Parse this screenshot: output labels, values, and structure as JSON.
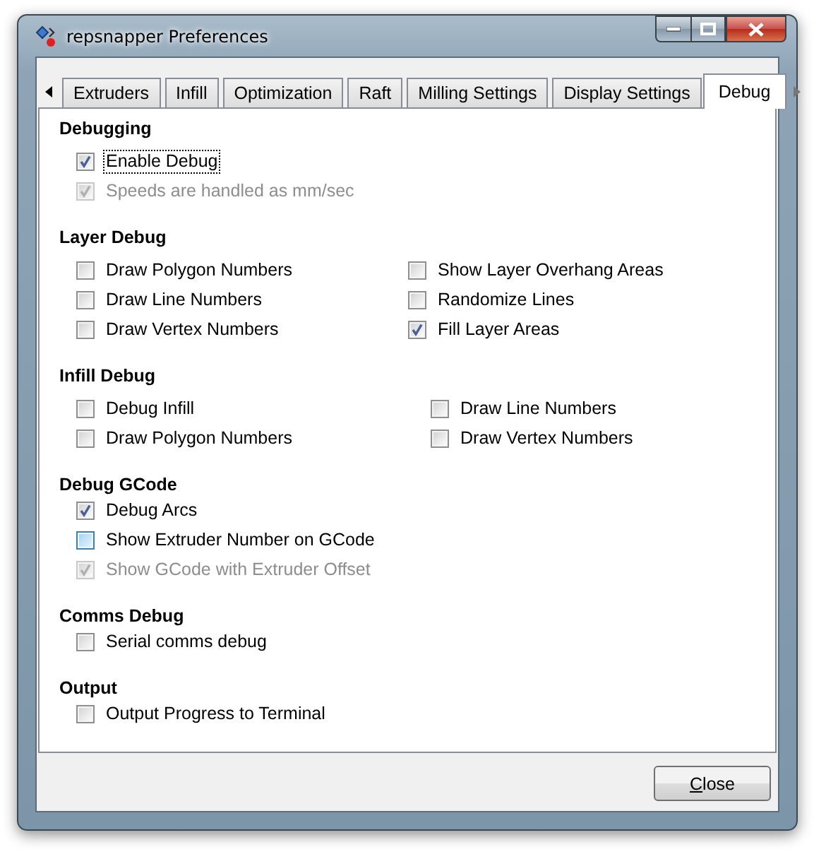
{
  "window": {
    "title": "repsnapper Preferences"
  },
  "tabs": [
    {
      "label": "Extruders",
      "selected": false
    },
    {
      "label": "Infill",
      "selected": false
    },
    {
      "label": "Optimization",
      "selected": false
    },
    {
      "label": "Raft",
      "selected": false
    },
    {
      "label": "Milling Settings",
      "selected": false
    },
    {
      "label": "Display Settings",
      "selected": false
    },
    {
      "label": "Debug",
      "selected": true
    }
  ],
  "sections": [
    {
      "heading": "Debugging",
      "columns": [
        [
          {
            "kind": "plain",
            "label": "Enable Debug",
            "checked": true,
            "disabled": false,
            "focused": true
          },
          {
            "kind": "plain",
            "label": "Speeds are handled as mm/sec",
            "checked": true,
            "disabled": true,
            "focused": false
          }
        ]
      ]
    },
    {
      "heading": "Layer Debug",
      "columns": [
        [
          {
            "kind": "plain",
            "label": "Draw Polygon Numbers",
            "checked": false,
            "disabled": false,
            "focused": false
          },
          {
            "kind": "plain",
            "label": "Draw Line Numbers",
            "checked": false,
            "disabled": false,
            "focused": false
          },
          {
            "kind": "plain",
            "label": "Draw Vertex Numbers",
            "checked": false,
            "disabled": false,
            "focused": false
          }
        ],
        [
          {
            "kind": "plain",
            "label": "Show Layer Overhang Areas",
            "checked": false,
            "disabled": false,
            "focused": false
          },
          {
            "kind": "plain",
            "label": "Randomize Lines",
            "checked": false,
            "disabled": false,
            "focused": false
          },
          {
            "kind": "plain",
            "label": "Fill Layer Areas",
            "checked": true,
            "disabled": false,
            "focused": false
          }
        ]
      ]
    },
    {
      "heading": "Infill Debug",
      "columns": [
        [
          {
            "kind": "plain",
            "label": "Debug Infill",
            "checked": false,
            "disabled": false,
            "focused": false
          },
          {
            "kind": "plain",
            "label": "Draw Polygon Numbers",
            "checked": false,
            "disabled": false,
            "focused": false
          }
        ],
        [
          {
            "kind": "plain",
            "label": "Draw Line Numbers",
            "checked": false,
            "disabled": false,
            "focused": false
          },
          {
            "kind": "plain",
            "label": "Draw Vertex Numbers",
            "checked": false,
            "disabled": false,
            "focused": false
          }
        ]
      ]
    },
    {
      "heading": "Debug GCode",
      "columns": [
        [
          {
            "kind": "plain",
            "label": "Debug Arcs",
            "checked": true,
            "disabled": false,
            "focused": false
          },
          {
            "kind": "hover",
            "label": "Show Extruder Number on GCode",
            "checked": false,
            "disabled": false,
            "focused": false
          },
          {
            "kind": "plain",
            "label": "Show GCode with Extruder Offset",
            "checked": true,
            "disabled": true,
            "focused": false
          }
        ]
      ]
    },
    {
      "heading": "Comms Debug",
      "columns": [
        [
          {
            "kind": "plain",
            "label": "Serial comms debug",
            "checked": false,
            "disabled": false,
            "focused": false
          }
        ]
      ]
    },
    {
      "heading": "Output",
      "columns": [
        [
          {
            "kind": "plain",
            "label": "Output Progress to Terminal",
            "checked": false,
            "disabled": false,
            "focused": false
          }
        ]
      ]
    }
  ],
  "buttons": [
    {
      "label": "Close"
    }
  ]
}
